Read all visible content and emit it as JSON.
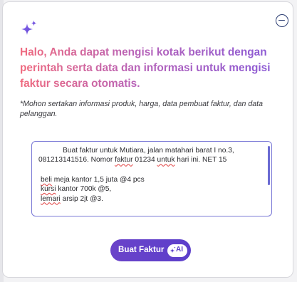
{
  "dialog": {
    "heading": "Halo, Anda dapat mengisi kotak berikut dengan perintah serta data dan informasi untuk mengisi faktur secara otomatis.",
    "note": "*Mohon sertakan informasi produk, harga, data pembuat faktur, dan data pelanggan.",
    "sparkle_icon": "sparkle-icon",
    "close_icon": "minus-circle-icon"
  },
  "prompt_input": {
    "line1_part1": "Buat faktur untuk ",
    "line1_name": "Mutiara",
    "line1_part2": ", jalan matahari barat I no.3,",
    "line2_phone": "081213141516.",
    "line2_part1": " Nomor ",
    "line2_word": "faktur",
    "line2_part2": " 01234 ",
    "line2_word2": "untuk",
    "line2_part3": " hari ini. NET 15",
    "item1_word": "beli",
    "item1_rest": " meja kantor 1,5 juta @4 pcs",
    "item2_word": "kursi",
    "item2_rest": " kantor 700k @5,",
    "item3_word": "lemari",
    "item3_rest": " arsip 2jt @3."
  },
  "submit_button": {
    "label": "Buat Faktur",
    "badge": "AI"
  },
  "colors": {
    "accent": "#5c3fcb",
    "heading_gradient_start": "#f06a7e",
    "heading_gradient_end": "#8a5ad6",
    "input_border": "#7a79d6"
  }
}
